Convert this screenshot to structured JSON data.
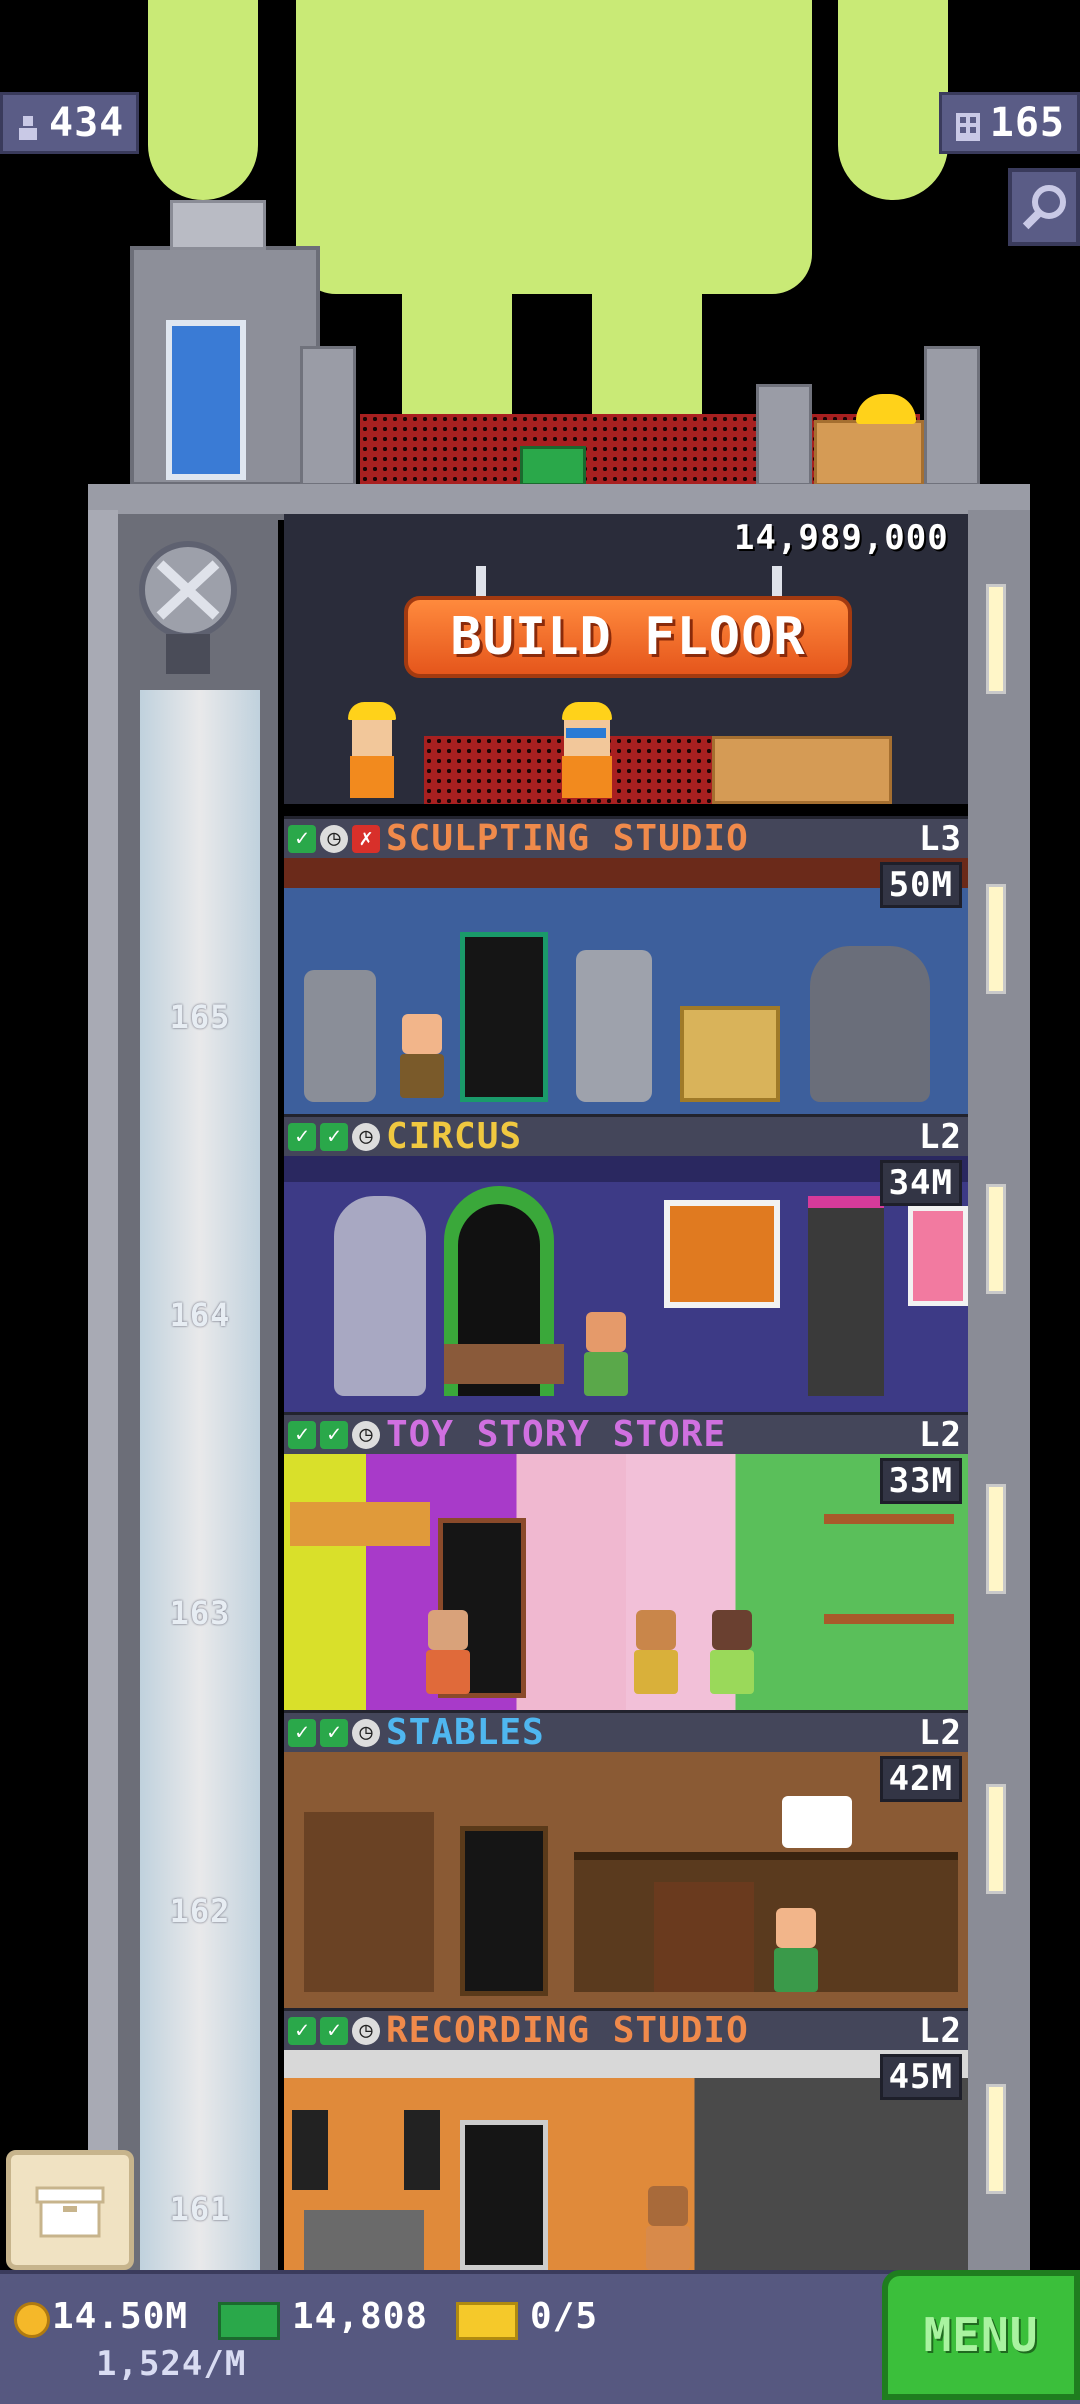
{
  "top": {
    "population": "434",
    "floors": "165"
  },
  "build": {
    "price": "14,989,000",
    "button_label": "BUILD FLOOR"
  },
  "floors": [
    {
      "number": "165",
      "name": "SCULPTING STUDIO",
      "level": "L3",
      "price": "50M",
      "name_color": "#f08a4b",
      "status": [
        "ok",
        "clock",
        "no"
      ]
    },
    {
      "number": "164",
      "name": "CIRCUS",
      "level": "L2",
      "price": "34M",
      "name_color": "#f0c840",
      "status": [
        "ok",
        "ok",
        "clock"
      ]
    },
    {
      "number": "163",
      "name": "TOY STORY STORE",
      "level": "L2",
      "price": "33M",
      "name_color": "#d070e0",
      "status": [
        "ok",
        "ok",
        "clock"
      ]
    },
    {
      "number": "162",
      "name": "STABLES",
      "level": "L2",
      "price": "42M",
      "name_color": "#4fb7f0",
      "status": [
        "ok",
        "ok",
        "clock"
      ]
    },
    {
      "number": "161",
      "name": "RECORDING STUDIO",
      "level": "L2",
      "price": "45M",
      "name_color": "#f08a4b",
      "status": [
        "ok",
        "ok",
        "clock"
      ]
    }
  ],
  "bottom": {
    "coins": "14.50M",
    "coin_rate": "1,524/M",
    "bux": "14,808",
    "vip": "0/5",
    "menu_label": "MENU"
  },
  "colors": {
    "coin": "#f5b829",
    "bux": "#2aa84a",
    "menu": "#3bbf3b"
  }
}
